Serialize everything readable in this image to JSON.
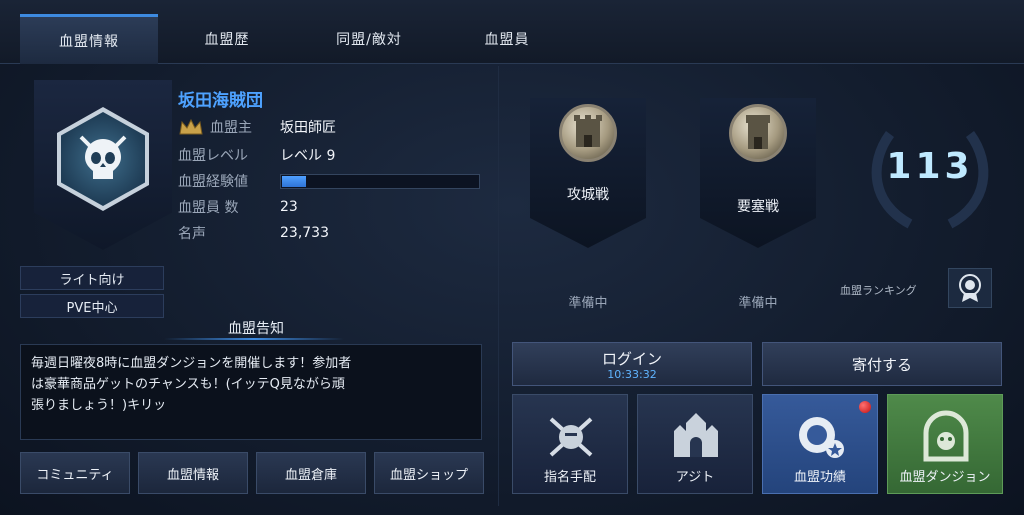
{
  "tabs": [
    {
      "label": "血盟情報",
      "active": true
    },
    {
      "label": "血盟歴",
      "active": false
    },
    {
      "label": "同盟/敵対",
      "active": false
    },
    {
      "label": "血盟員",
      "active": false
    }
  ],
  "clan": {
    "name": "坂田海賊団",
    "leader_label": "血盟主",
    "leader": "坂田師匠",
    "level_label": "血盟レベル",
    "level": "レベル 9",
    "exp_label": "血盟経験値",
    "exp_fraction": 0.12,
    "members_label": "血盟員 数",
    "members": "23",
    "fame_label": "名声",
    "fame": "23,733",
    "tags": [
      "ライト向け",
      "PVE中心"
    ]
  },
  "notice": {
    "title": "血盟告知",
    "lines": [
      "毎週日曜夜8時に血盟ダンジョンを開催します！参加者",
      "は豪華商品ゲットのチャンスも！(イッテQ見ながら頑",
      "張りましょう！)キリッ"
    ]
  },
  "left_buttons": [
    "コミュニティ",
    "血盟情報",
    "血盟倉庫",
    "血盟ショップ"
  ],
  "wars": [
    {
      "title": "攻城戦",
      "status": "準備中"
    },
    {
      "title": "要塞戦",
      "status": "準備中"
    }
  ],
  "ranking": {
    "value": "113",
    "label": "血盟ランキング"
  },
  "actions": {
    "login_label": "ログイン",
    "login_time": "10:33:32",
    "donate_label": "寄付する"
  },
  "features": [
    {
      "label": "指名手配",
      "icon": "wanted-icon",
      "style": "default"
    },
    {
      "label": "アジト",
      "icon": "hideout-icon",
      "style": "default"
    },
    {
      "label": "血盟功績",
      "icon": "achievement-icon",
      "style": "blue",
      "notification": true
    },
    {
      "label": "血盟ダンジョン",
      "icon": "dungeon-icon",
      "style": "green"
    }
  ],
  "colors": {
    "accent": "#3d8ae0",
    "clan_name": "#4ea2ff",
    "login_time": "#5fb4ff"
  }
}
